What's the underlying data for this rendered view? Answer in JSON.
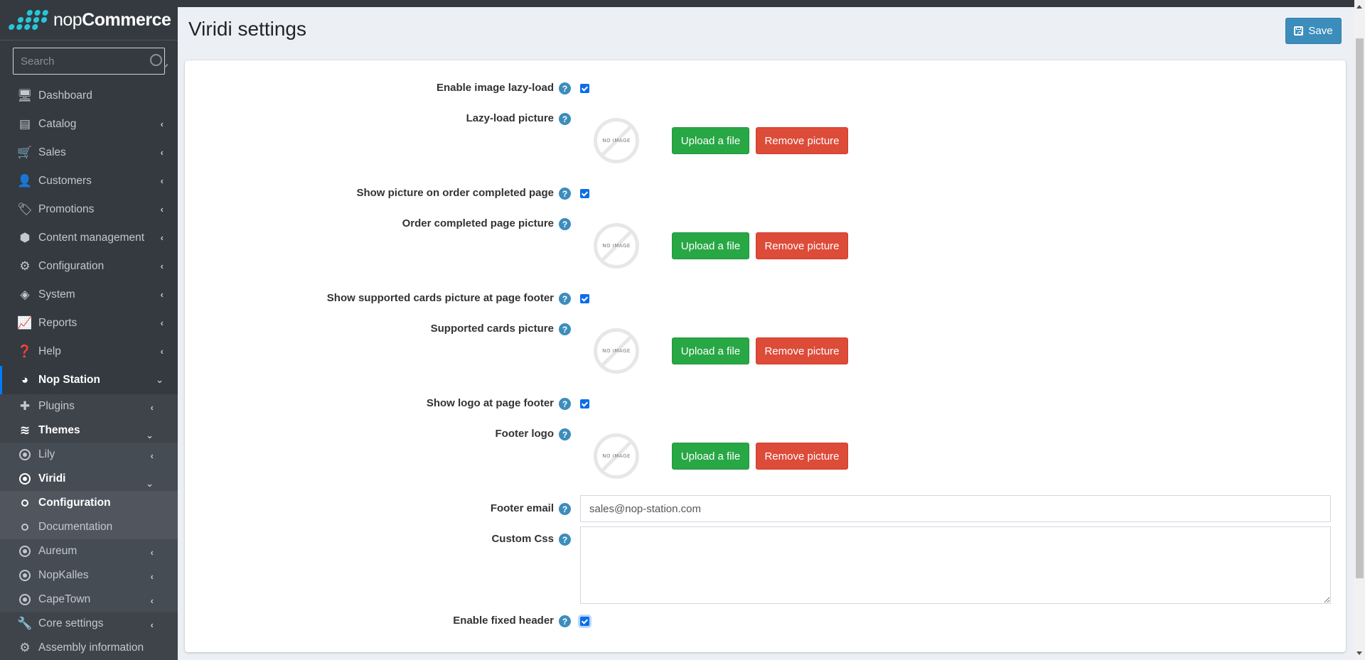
{
  "brand": {
    "prefix": "nop",
    "suffix": "Commerce"
  },
  "search": {
    "placeholder": "Search"
  },
  "sidebar": {
    "items": [
      {
        "label": "Dashboard",
        "icon": "monitor-icon"
      },
      {
        "label": "Catalog",
        "icon": "book-icon"
      },
      {
        "label": "Sales",
        "icon": "cart-icon"
      },
      {
        "label": "Customers",
        "icon": "user-icon"
      },
      {
        "label": "Promotions",
        "icon": "tags-icon"
      },
      {
        "label": "Content management",
        "icon": "cubes-icon"
      },
      {
        "label": "Configuration",
        "icon": "gears-icon"
      },
      {
        "label": "System",
        "icon": "cube-icon"
      },
      {
        "label": "Reports",
        "icon": "line-chart-icon"
      },
      {
        "label": "Help",
        "icon": "question-circle-icon"
      },
      {
        "label": "Nop Station",
        "icon": "pie-chart-icon"
      }
    ],
    "nopstation": [
      {
        "label": "Plugins",
        "icon": "puzzle-icon"
      },
      {
        "label": "Themes",
        "icon": "layers-icon"
      }
    ],
    "themes": [
      {
        "label": "Lily"
      },
      {
        "label": "Viridi"
      },
      {
        "label": "Aureum"
      },
      {
        "label": "NopKalles"
      },
      {
        "label": "CapeTown"
      }
    ],
    "viridi": [
      {
        "label": "Configuration"
      },
      {
        "label": "Documentation"
      }
    ],
    "bottom": [
      {
        "label": "Core settings",
        "icon": "wrench-icon"
      },
      {
        "label": "Assembly information",
        "icon": "gear-icon"
      }
    ]
  },
  "header": {
    "title": "Viridi settings",
    "save_label": "Save"
  },
  "form": {
    "enable_lazy_load": {
      "label": "Enable image lazy-load",
      "checked": true
    },
    "lazy_load_picture": {
      "label": "Lazy-load picture"
    },
    "show_order_completed_picture": {
      "label": "Show picture on order completed page",
      "checked": true
    },
    "order_completed_picture": {
      "label": "Order completed page picture"
    },
    "show_supported_cards": {
      "label": "Show supported cards picture at page footer",
      "checked": true
    },
    "supported_cards_picture": {
      "label": "Supported cards picture"
    },
    "show_footer_logo": {
      "label": "Show logo at page footer",
      "checked": true
    },
    "footer_logo": {
      "label": "Footer logo"
    },
    "footer_email": {
      "label": "Footer email",
      "value": "sales@nop-station.com"
    },
    "custom_css": {
      "label": "Custom Css",
      "value": ""
    },
    "enable_fixed_header": {
      "label": "Enable fixed header",
      "checked": true
    },
    "no_image_text": "NO IMAGE",
    "upload_label": "Upload a file",
    "remove_label": "Remove picture",
    "help_glyph": "?"
  },
  "colors": {
    "sidebar_bg": "#343a40",
    "accent_blue": "#3c8dbc",
    "upload_green": "#28a745",
    "remove_red": "#dd4b39",
    "active_indicator": "#007bff",
    "brand_dots": "#26c6da"
  }
}
